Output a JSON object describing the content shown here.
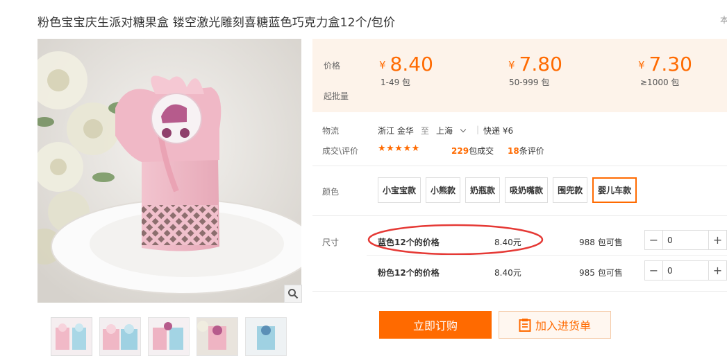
{
  "title": "粉色宝宝庆生派对糖果盒 镂空激光雕刻喜糖蓝色巧克力盒12个/包价",
  "title_right": "本",
  "price": {
    "label": "价格",
    "moq_label": "起批量",
    "tiers": [
      {
        "currency": "¥",
        "price": "8.40",
        "moq": "1-49 包"
      },
      {
        "currency": "¥",
        "price": "7.80",
        "moq": "50-999 包"
      },
      {
        "currency": "¥",
        "price": "7.30",
        "moq": "≥1000 包"
      }
    ]
  },
  "logistics": {
    "label": "物流",
    "from": "浙江 金华",
    "to_word": "至",
    "to": "上海",
    "shipping": "快递 ¥6"
  },
  "deals": {
    "label": "成交\\评价",
    "stars": "★★★★★",
    "deal_count": "229",
    "deal_suffix": "包成交",
    "review_count": "18",
    "review_suffix": "条评价"
  },
  "color": {
    "label": "颜色",
    "options": [
      "小宝宝款",
      "小熊款",
      "奶瓶款",
      "吸奶嘴款",
      "围兜款",
      "婴儿车款"
    ],
    "selected": "婴儿车款"
  },
  "size": {
    "label": "尺寸",
    "rows": [
      {
        "name": "蓝色12个的价格",
        "price": "8.40元",
        "stock": "988 包可售",
        "qty": "0"
      },
      {
        "name": "粉色12个的价格",
        "price": "8.40元",
        "stock": "985 包可售",
        "qty": "0"
      }
    ]
  },
  "actions": {
    "order": "立即订购",
    "cart": "加入进货单"
  },
  "colors": {
    "accent": "#ff6a00",
    "price_bg": "#fdf3ea",
    "highlight": "#e53935"
  }
}
